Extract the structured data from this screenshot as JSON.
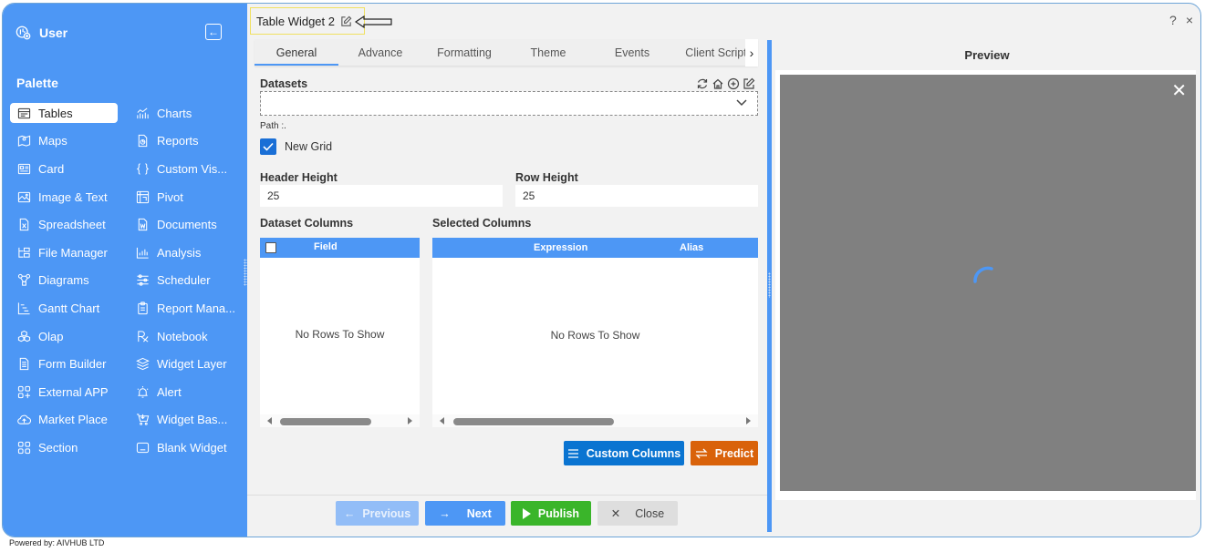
{
  "sidebar": {
    "user_label": "User",
    "palette_title": "Palette",
    "items": [
      {
        "label": "Tables",
        "icon": "table-icon",
        "active": true
      },
      {
        "label": "Charts",
        "icon": "chart-icon"
      },
      {
        "label": "Maps",
        "icon": "map-icon"
      },
      {
        "label": "Reports",
        "icon": "report-icon"
      },
      {
        "label": "Card",
        "icon": "card-icon"
      },
      {
        "label": "Custom Vis...",
        "icon": "braces-icon"
      },
      {
        "label": "Image & Text",
        "icon": "image-icon"
      },
      {
        "label": "Pivot",
        "icon": "pivot-icon"
      },
      {
        "label": "Spreadsheet",
        "icon": "spreadsheet-icon"
      },
      {
        "label": "Documents",
        "icon": "document-icon"
      },
      {
        "label": "File Manager",
        "icon": "file-manager-icon"
      },
      {
        "label": "Analysis",
        "icon": "analysis-icon"
      },
      {
        "label": "Diagrams",
        "icon": "diagram-icon"
      },
      {
        "label": "Scheduler",
        "icon": "scheduler-icon"
      },
      {
        "label": "Gantt Chart",
        "icon": "gantt-icon"
      },
      {
        "label": "Report Mana...",
        "icon": "clipboard-icon"
      },
      {
        "label": "Olap",
        "icon": "olap-icon"
      },
      {
        "label": "Notebook",
        "icon": "notebook-icon"
      },
      {
        "label": "Form Builder",
        "icon": "form-icon"
      },
      {
        "label": "Widget Layer",
        "icon": "layers-icon"
      },
      {
        "label": "External APP",
        "icon": "external-app-icon"
      },
      {
        "label": "Alert",
        "icon": "bell-icon"
      },
      {
        "label": "Market Place",
        "icon": "cloud-upload-icon"
      },
      {
        "label": "Widget Bas...",
        "icon": "cart-icon"
      },
      {
        "label": "Section",
        "icon": "section-icon"
      },
      {
        "label": "Blank Widget",
        "icon": "blank-widget-icon"
      }
    ]
  },
  "header": {
    "widget_title": "Table Widget 2"
  },
  "tabs": [
    {
      "label": "General",
      "active": true
    },
    {
      "label": "Advance"
    },
    {
      "label": "Formatting"
    },
    {
      "label": "Theme"
    },
    {
      "label": "Events"
    },
    {
      "label": "Client Script"
    }
  ],
  "form": {
    "datasets_label": "Datasets",
    "dataset_value": "",
    "path_label": "Path :.",
    "new_grid_label": "New Grid",
    "new_grid_checked": true,
    "header_height_label": "Header Height",
    "header_height_value": "25",
    "row_height_label": "Row Height",
    "row_height_value": "25",
    "dataset_columns_label": "Dataset Columns",
    "selected_columns_label": "Selected Columns",
    "dataset_grid": {
      "headers": [
        "Field"
      ],
      "empty_text": "No Rows To Show"
    },
    "selected_grid": {
      "headers": [
        "Expression",
        "Alias"
      ],
      "empty_text": "No Rows To Show"
    }
  },
  "actions": {
    "custom_columns": "Custom Columns",
    "predict": "Predict",
    "previous": "Previous",
    "next": "Next",
    "publish": "Publish",
    "close": "Close"
  },
  "colors": {
    "primary": "#4d97f5",
    "custom_columns": "#0a74d1",
    "predict": "#d9620a",
    "publish": "#3ab52a",
    "previous_disabled": "#92bdf7",
    "close": "#dedede"
  },
  "preview": {
    "title": "Preview",
    "help": "?",
    "close": "×",
    "state": "loading"
  },
  "footer": {
    "powered_by": "Powered by: AIVHUB LTD"
  }
}
